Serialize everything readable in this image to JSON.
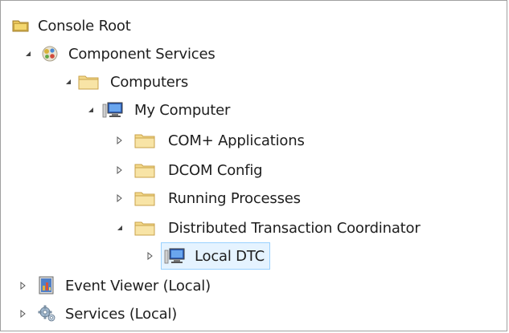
{
  "tree": {
    "items": [
      {
        "label": "Console Root",
        "icon": "folder-open-icon",
        "expander": "none"
      },
      {
        "label": "Component Services",
        "icon": "component-services-icon",
        "expander": "expanded"
      },
      {
        "label": "Computers",
        "icon": "folder-icon",
        "expander": "expanded"
      },
      {
        "label": "My Computer",
        "icon": "computer-icon",
        "expander": "expanded"
      },
      {
        "label": "COM+ Applications",
        "icon": "folder-icon",
        "expander": "collapsed"
      },
      {
        "label": "DCOM Config",
        "icon": "folder-icon",
        "expander": "collapsed"
      },
      {
        "label": "Running Processes",
        "icon": "folder-icon",
        "expander": "collapsed"
      },
      {
        "label": "Distributed Transaction Coordinator",
        "icon": "folder-icon",
        "expander": "expanded"
      },
      {
        "label": "Local DTC",
        "icon": "computer-icon",
        "expander": "collapsed",
        "selected": true
      },
      {
        "label": "Event Viewer (Local)",
        "icon": "event-viewer-icon",
        "expander": "collapsed"
      },
      {
        "label": "Services (Local)",
        "icon": "services-gear-icon",
        "expander": "collapsed"
      }
    ]
  },
  "colors": {
    "selection_bg": "#e5f3ff",
    "selection_border": "#99d1ff",
    "folder": "#f5d47a"
  }
}
